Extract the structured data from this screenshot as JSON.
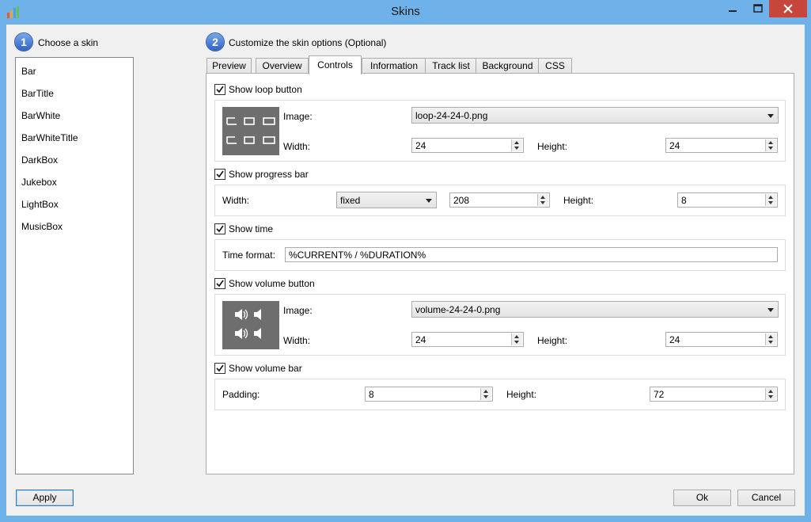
{
  "window": {
    "title": "Skins"
  },
  "step1": {
    "number": "1",
    "label": "Choose a skin"
  },
  "step2": {
    "number": "2",
    "label": "Customize the skin options (Optional)"
  },
  "skins": [
    "Bar",
    "BarTitle",
    "BarWhite",
    "BarWhiteTitle",
    "DarkBox",
    "Jukebox",
    "LightBox",
    "MusicBox"
  ],
  "tabs": [
    "Preview",
    "Overview",
    "Controls",
    "Information",
    "Track list",
    "Background",
    "CSS"
  ],
  "active_tab": "Controls",
  "loop": {
    "checkbox_label": "Show loop button",
    "checked": true,
    "image_label": "Image:",
    "image_value": "loop-24-24-0.png",
    "width_label": "Width:",
    "width_value": "24",
    "height_label": "Height:",
    "height_value": "24"
  },
  "progress": {
    "checkbox_label": "Show progress bar",
    "checked": true,
    "width_label": "Width:",
    "width_mode": "fixed",
    "width_value": "208",
    "height_label": "Height:",
    "height_value": "8"
  },
  "time": {
    "checkbox_label": "Show time",
    "checked": true,
    "format_label": "Time format:",
    "format_value": "%CURRENT% / %DURATION%"
  },
  "volume_button": {
    "checkbox_label": "Show volume button",
    "checked": true,
    "image_label": "Image:",
    "image_value": "volume-24-24-0.png",
    "width_label": "Width:",
    "width_value": "24",
    "height_label": "Height:",
    "height_value": "24"
  },
  "volume_bar": {
    "checkbox_label": "Show volume bar",
    "checked": true,
    "padding_label": "Padding:",
    "padding_value": "8",
    "height_label": "Height:",
    "height_value": "72"
  },
  "buttons": {
    "apply": "Apply",
    "ok": "Ok",
    "cancel": "Cancel"
  },
  "colors": {
    "title_bar": "#6fb2ea",
    "close_button": "#c7463c",
    "step_badge": "#2d62c4"
  }
}
